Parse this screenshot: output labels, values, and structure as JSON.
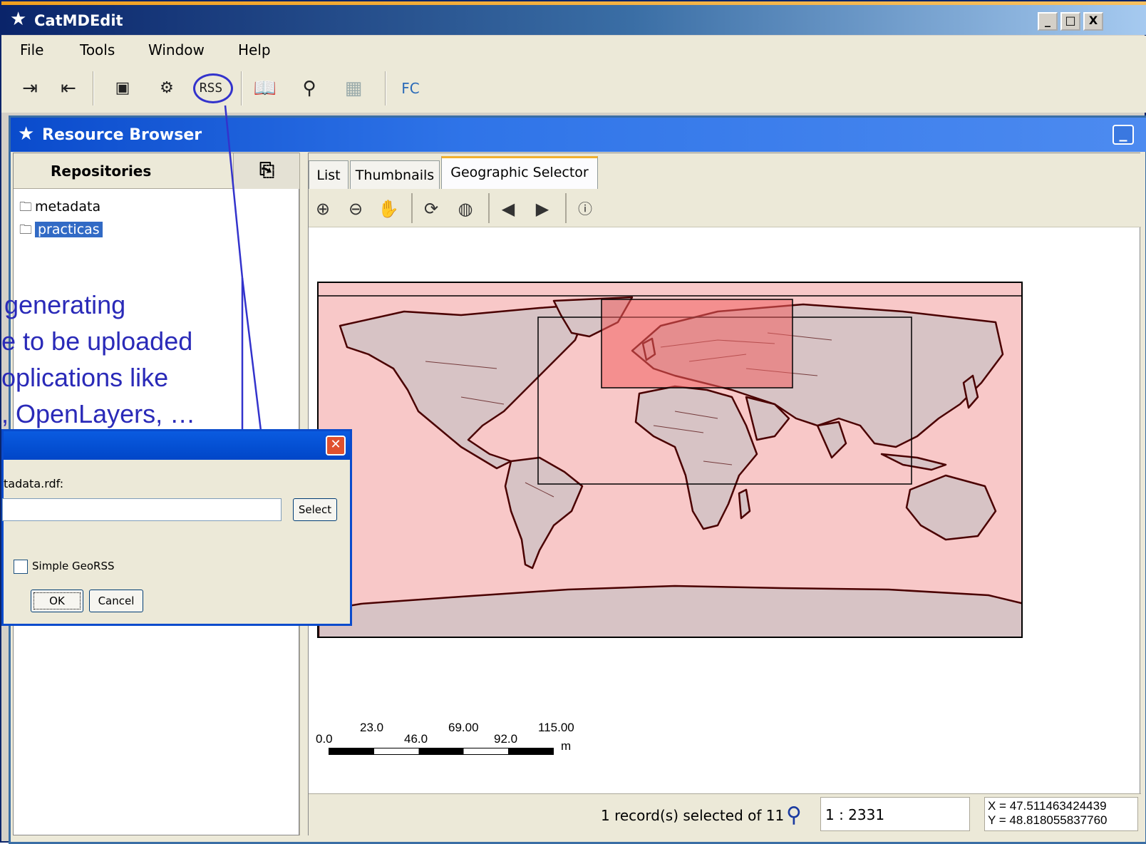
{
  "window": {
    "title": "CatMDEdit",
    "min_btn": "_",
    "max_btn": "□",
    "close_btn": "X"
  },
  "menu": [
    "File",
    "Tools",
    "Window",
    "Help"
  ],
  "toolbar": {
    "rss_label": "RSS",
    "fc_label": "FC"
  },
  "panel": {
    "title": "Resource Browser"
  },
  "repositories": {
    "header": "Repositories",
    "items": [
      "metadata",
      "practicas"
    ],
    "selected": "practicas"
  },
  "tabs": [
    "List",
    "Thumbnails",
    "Geographic Selector"
  ],
  "active_tab": "Geographic Selector",
  "scalebar": {
    "top_labels": [
      "23.0",
      "69.00",
      "115.00"
    ],
    "bottom_labels": [
      "0.0",
      "46.0",
      "92.0"
    ],
    "unit": "m"
  },
  "status": {
    "records": "1 record(s) selected of 11",
    "scale": "1 : 2331",
    "x": "X = 47.511463424439",
    "y": "Y = 48.818055837760"
  },
  "annotation": [
    "generating",
    "e to be uploaded",
    "oplications like",
    ", OpenLayers, …"
  ],
  "dialog": {
    "label": "tadata.rdf:",
    "select_btn": "Select",
    "checkbox_label": "Simple GeoRSS",
    "ok_btn": "OK",
    "cancel_btn": "Cancel"
  },
  "colors": {
    "title_blue": "#0a246a",
    "panel_blue": "#2f74e8",
    "annotation_blue": "#2a2ab8",
    "map_bg": "#f8c8c8",
    "land": "#d7c3c5",
    "selection": "#f06060"
  }
}
